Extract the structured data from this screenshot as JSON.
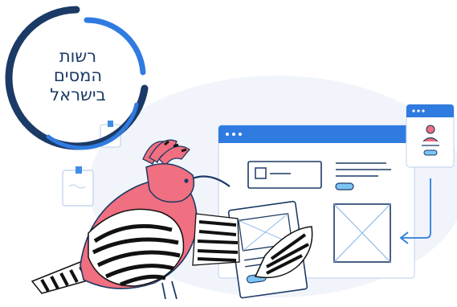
{
  "logo": {
    "name": "Israel Tax Authority emblem",
    "lines": [
      "רשות",
      "המסים",
      "בישראל"
    ]
  },
  "illustration": {
    "subject": "hoopoe bird holding a form beside browser windows",
    "colors": {
      "navy": "#1b3a66",
      "blue_accent": "#2f7be0",
      "bird_pink": "#f06f80",
      "panel_bg": "#eef3fb",
      "stripe": "#111111"
    },
    "icons": [
      "image-placeholder-icon",
      "profile-card-icon",
      "arrow-icon",
      "pin-icon"
    ]
  }
}
